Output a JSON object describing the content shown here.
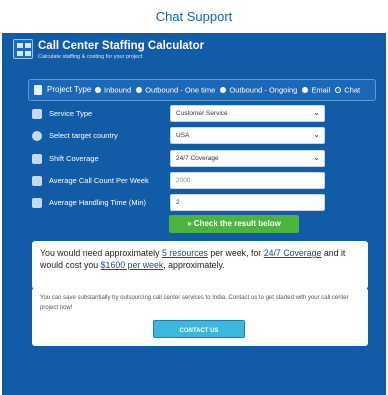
{
  "page": {
    "heading": "Chat Support"
  },
  "widget": {
    "title": "Call Center Staffing Calculator",
    "subtitle": "Calculate staffing & costing for your project"
  },
  "project_type": {
    "label": "Project Type",
    "options": [
      {
        "label": "Inbound",
        "selected": false
      },
      {
        "label": "Outbound - One time",
        "selected": false
      },
      {
        "label": "Outbound - Ongoing",
        "selected": false
      },
      {
        "label": "Email",
        "selected": false
      },
      {
        "label": "Chat",
        "selected": true
      }
    ]
  },
  "form": {
    "service_type": {
      "label": "Service Type",
      "value": "Customer Service"
    },
    "country": {
      "label": "Select target country",
      "value": "USA"
    },
    "shift": {
      "label": "Shift Coverage",
      "value": "24/7 Coverage"
    },
    "call_count": {
      "label": "Average Call Count Per Week",
      "placeholder": "2000"
    },
    "handling_time": {
      "label": "Average Handling Time (Min)",
      "value": "2"
    },
    "submit_label": "»  Check the result below"
  },
  "result": {
    "prefix": "You would need approximately",
    "resources": "5 resources",
    "mid1": "per week, for",
    "coverage": "24/7 Coverage",
    "mid2": "and it would cost you",
    "cost": "$1600 per week",
    "suffix": ", approximately."
  },
  "cta": {
    "text": "You can save substantially by outsourcing call center services to India. Contact us to get started with your call center project now!",
    "button_label": "CONTACT US"
  }
}
